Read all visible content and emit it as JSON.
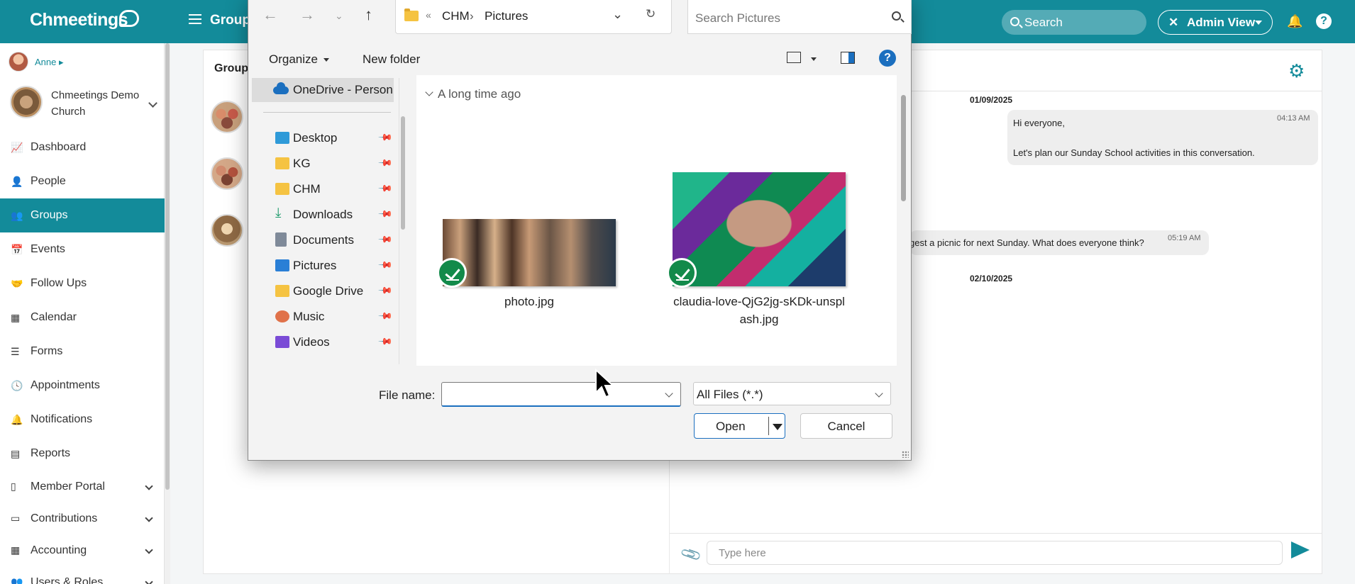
{
  "app": {
    "logo": "Chmeetings",
    "page_title": "Group",
    "search_label": "Search",
    "admin_view": "Admin View",
    "brand_color": "#138b9a"
  },
  "sidebar": {
    "user_name": "Anne",
    "church_name": "Chmeetings Demo Church",
    "items": [
      {
        "label": "Dashboard",
        "icon": "chart-line-icon"
      },
      {
        "label": "People",
        "icon": "person-icon"
      },
      {
        "label": "Groups",
        "icon": "users-icon",
        "active": true
      },
      {
        "label": "Events",
        "icon": "calendar-icon"
      },
      {
        "label": "Follow Ups",
        "icon": "handshake-icon"
      },
      {
        "label": "Calendar",
        "icon": "calendar-grid-icon"
      },
      {
        "label": "Forms",
        "icon": "list-icon"
      },
      {
        "label": "Appointments",
        "icon": "clock-icon"
      },
      {
        "label": "Notifications",
        "icon": "bell-icon"
      },
      {
        "label": "Reports",
        "icon": "bar-chart-icon"
      },
      {
        "label": "Member Portal",
        "icon": "mobile-icon"
      },
      {
        "label": "Contributions",
        "icon": "money-icon"
      },
      {
        "label": "Accounting",
        "icon": "grid-icon"
      },
      {
        "label": "Users & Roles",
        "icon": "users-cog-icon"
      }
    ]
  },
  "groups_panel": {
    "heading": "Group"
  },
  "chat": {
    "messages": [
      {
        "date": "01/09/2025"
      },
      {
        "text_line1": "Hi everyone,",
        "text_line2": "Let's plan our Sunday School activities in this conversation.",
        "time": "04:13 AM"
      },
      {
        "text": "gest a picnic for next Sunday. What does everyone think?",
        "time": "05:19 AM"
      },
      {
        "date": "02/10/2025"
      }
    ],
    "input_placeholder": "Type here"
  },
  "file_dialog": {
    "breadcrumb_prefix": "«",
    "breadcrumb": [
      "CHM",
      "Pictures"
    ],
    "search_placeholder": "Search Pictures",
    "organize_label": "Organize",
    "new_folder_label": "New folder",
    "onedrive_label": "OneDrive - Person",
    "quick_access": [
      {
        "label": "Desktop",
        "icon": "desktop-icon",
        "color": "#2f9ad8"
      },
      {
        "label": "KG",
        "icon": "folder-icon",
        "color": "#f5c342"
      },
      {
        "label": "CHM",
        "icon": "folder-sync-icon",
        "color": "#f5c342"
      },
      {
        "label": "Downloads",
        "icon": "download-icon",
        "color": "#1a9a6a"
      },
      {
        "label": "Documents",
        "icon": "document-icon",
        "color": "#7f8a99"
      },
      {
        "label": "Pictures",
        "icon": "pictures-icon",
        "color": "#2a7fd6"
      },
      {
        "label": "Google Drive",
        "icon": "folder-icon",
        "color": "#f5c342"
      },
      {
        "label": "Music",
        "icon": "music-icon",
        "color": "#e0724a"
      },
      {
        "label": "Videos",
        "icon": "video-icon",
        "color": "#7a4bd6"
      }
    ],
    "group_heading": "A long time ago",
    "files": [
      {
        "name": "photo.jpg"
      },
      {
        "name_line1": "claudia-love-QjG2jg-sKDk-unspl",
        "name_line2": "ash.jpg"
      }
    ],
    "file_name_label": "File name:",
    "file_name_value": "",
    "file_type": "All Files (*.*)",
    "open_label": "Open",
    "cancel_label": "Cancel"
  }
}
